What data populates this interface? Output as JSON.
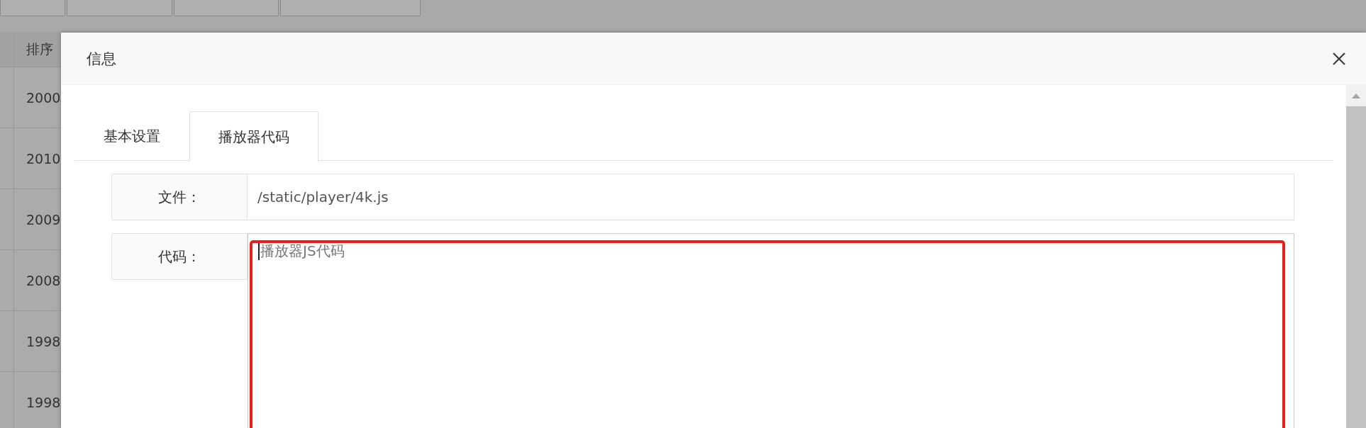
{
  "background": {
    "table": {
      "sort_column": {
        "header": "排序",
        "cells": [
          "2000",
          "2010",
          "2009",
          "2008",
          "1998",
          "1998"
        ]
      }
    }
  },
  "modal": {
    "title": "信息",
    "tabs": [
      {
        "label": "基本设置",
        "selected": false
      },
      {
        "label": "播放器代码",
        "selected": true
      }
    ],
    "fields": [
      {
        "kind": "input",
        "label": "文件：",
        "value": "/static/player/4k.js",
        "highlighted": false,
        "focused": false
      },
      {
        "kind": "textarea",
        "label": "代码：",
        "placeholder": "播放器JS代码",
        "highlighted": true,
        "focused": true
      }
    ]
  }
}
